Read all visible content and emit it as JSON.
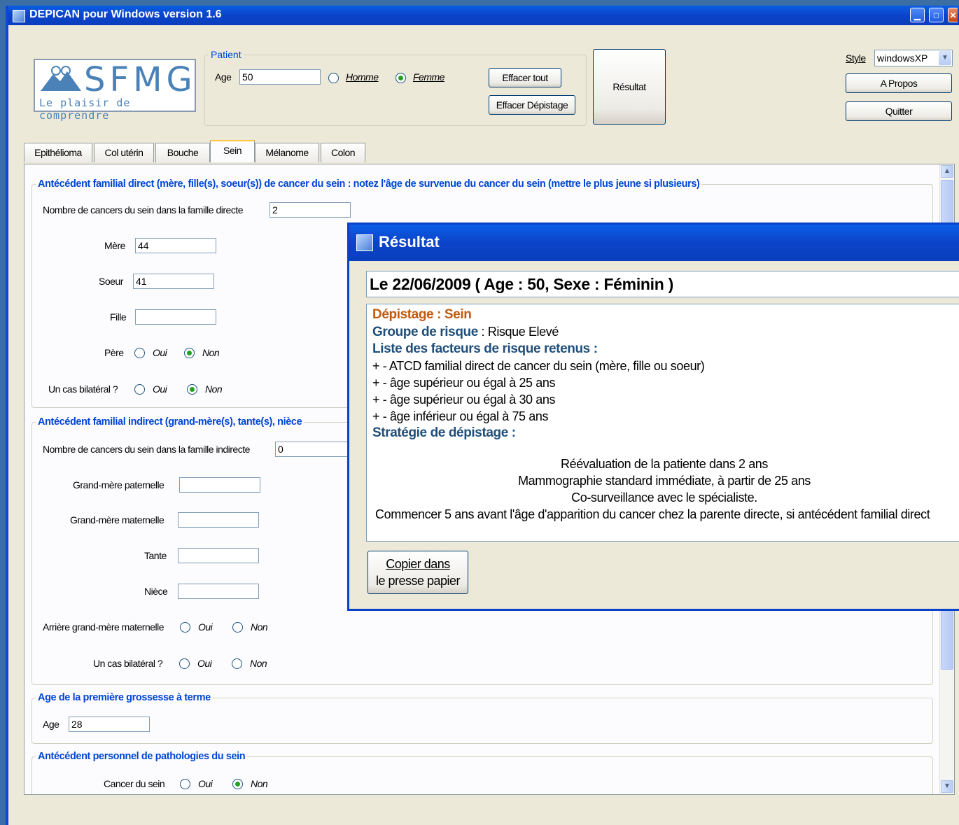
{
  "window": {
    "title": "DEPICAN pour Windows version 1.6"
  },
  "logo": {
    "brand": "SFMG",
    "tagline": "Le plaisir de comprendre"
  },
  "patient": {
    "legend": "Patient",
    "age_label": "Age",
    "age_value": "50",
    "homme_label": "Homme",
    "femme_label": "Femme",
    "selected_sex": "Femme"
  },
  "buttons": {
    "effacer_tout": "Effacer tout",
    "effacer_depistage": "Effacer Dépistage",
    "resultat": "Résultat",
    "style_label": "Style",
    "style_value": "windowsXP",
    "a_propos": "A Propos",
    "quitter": "Quitter"
  },
  "tabs": [
    "Epithélioma",
    "Col utérin",
    "Bouche",
    "Sein",
    "Mélanome",
    "Colon"
  ],
  "active_tab": "Sein",
  "direct": {
    "header": "Antécédent familial direct (mère, fille(s), soeur(s)) de cancer du sein : notez l'âge de survenue du cancer du sein (mettre le plus jeune si plusieurs)",
    "count_label": "Nombre de cancers du sein dans la famille directe",
    "count_value": "2",
    "mere_label": "Mère",
    "mere_value": "44",
    "soeur_label": "Soeur",
    "soeur_value": "41",
    "fille_label": "Fille",
    "fille_value": "",
    "pere_label": "Père",
    "bilateral_label": "Un cas bilatéral ?",
    "oui": "Oui",
    "non": "Non"
  },
  "indirect": {
    "header": "Antécédent familial indirect (grand-mère(s), tante(s), nièce",
    "count_label": "Nombre de cancers du sein dans la famille indirecte",
    "count_value": "0",
    "gm_paternelle": "Grand-mère paternelle",
    "gm_maternelle": "Grand-mère maternelle",
    "tante": "Tante",
    "niece": "Nièce",
    "arriere": "Arrière grand-mère maternelle",
    "bilateral_label": "Un cas bilatéral ?",
    "oui": "Oui",
    "non": "Non"
  },
  "grossesse": {
    "header": "Age de la première grossesse à terme",
    "age_label": "Age",
    "age_value": "28"
  },
  "personnel": {
    "header": "Antécédent personnel de pathologies du sein",
    "cancer_label": "Cancer du sein",
    "oui": "Oui",
    "non": "Non"
  },
  "result": {
    "title": "Résultat",
    "date_line": "Le 22/06/2009 ( Age : 50, Sexe : Féminin )",
    "depistage_label": "Dépistage : Sein",
    "groupe_label": "Groupe de risque",
    "groupe_value": " : Risque Elevé",
    "liste_label": "Liste des facteurs de risque retenus :",
    "factors": [
      "+ - ATCD familial direct de cancer du sein (mère, fille ou soeur)",
      "+ - âge supérieur ou égal à 25 ans",
      "+ - âge supérieur ou égal à 30 ans",
      "+ - âge inférieur ou égal à 75 ans"
    ],
    "strategie_label": "Stratégie de dépistage :",
    "strategy": [
      "Réévaluation de la patiente dans 2 ans",
      "Mammographie standard immédiate, à partir de 25 ans",
      "Co-surveillance avec le spécialiste.",
      "Commencer 5 ans avant l'âge d'apparition du cancer chez la parente directe, si antécédent familial direct"
    ],
    "copy_line1": "Copier dans",
    "copy_line2": "le presse papier"
  }
}
